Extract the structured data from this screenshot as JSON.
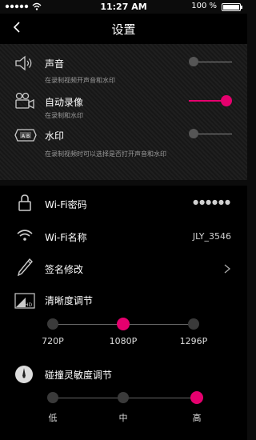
{
  "status": {
    "time": "11:27 AM",
    "battery": "100 %"
  },
  "nav": {
    "title": "设置"
  },
  "sound": {
    "label": "声音",
    "sub": "在录制视频开声音和水印",
    "on": false
  },
  "autorec": {
    "label": "自动录像",
    "sub": "在录制和水印",
    "on": true
  },
  "watermark": {
    "label": "水印",
    "sub": "在录制视频时可以选择是否打开声音和水印",
    "on": false
  },
  "wifi_pwd": {
    "label": "Wi-Fi密码",
    "value": "●●●●●●"
  },
  "wifi_name": {
    "label": "Wi-Fi名称",
    "value": "JLY_3546"
  },
  "signature": {
    "label": "签名修改"
  },
  "resolution": {
    "label": "清晰度调节",
    "options": [
      "720P",
      "1080P",
      "1296P"
    ],
    "selected": 1
  },
  "sensitivity": {
    "label": "碰撞灵敏度调节",
    "options": [
      "低",
      "中",
      "高"
    ],
    "selected": 2
  },
  "colors": {
    "accent": "#e5006e"
  }
}
